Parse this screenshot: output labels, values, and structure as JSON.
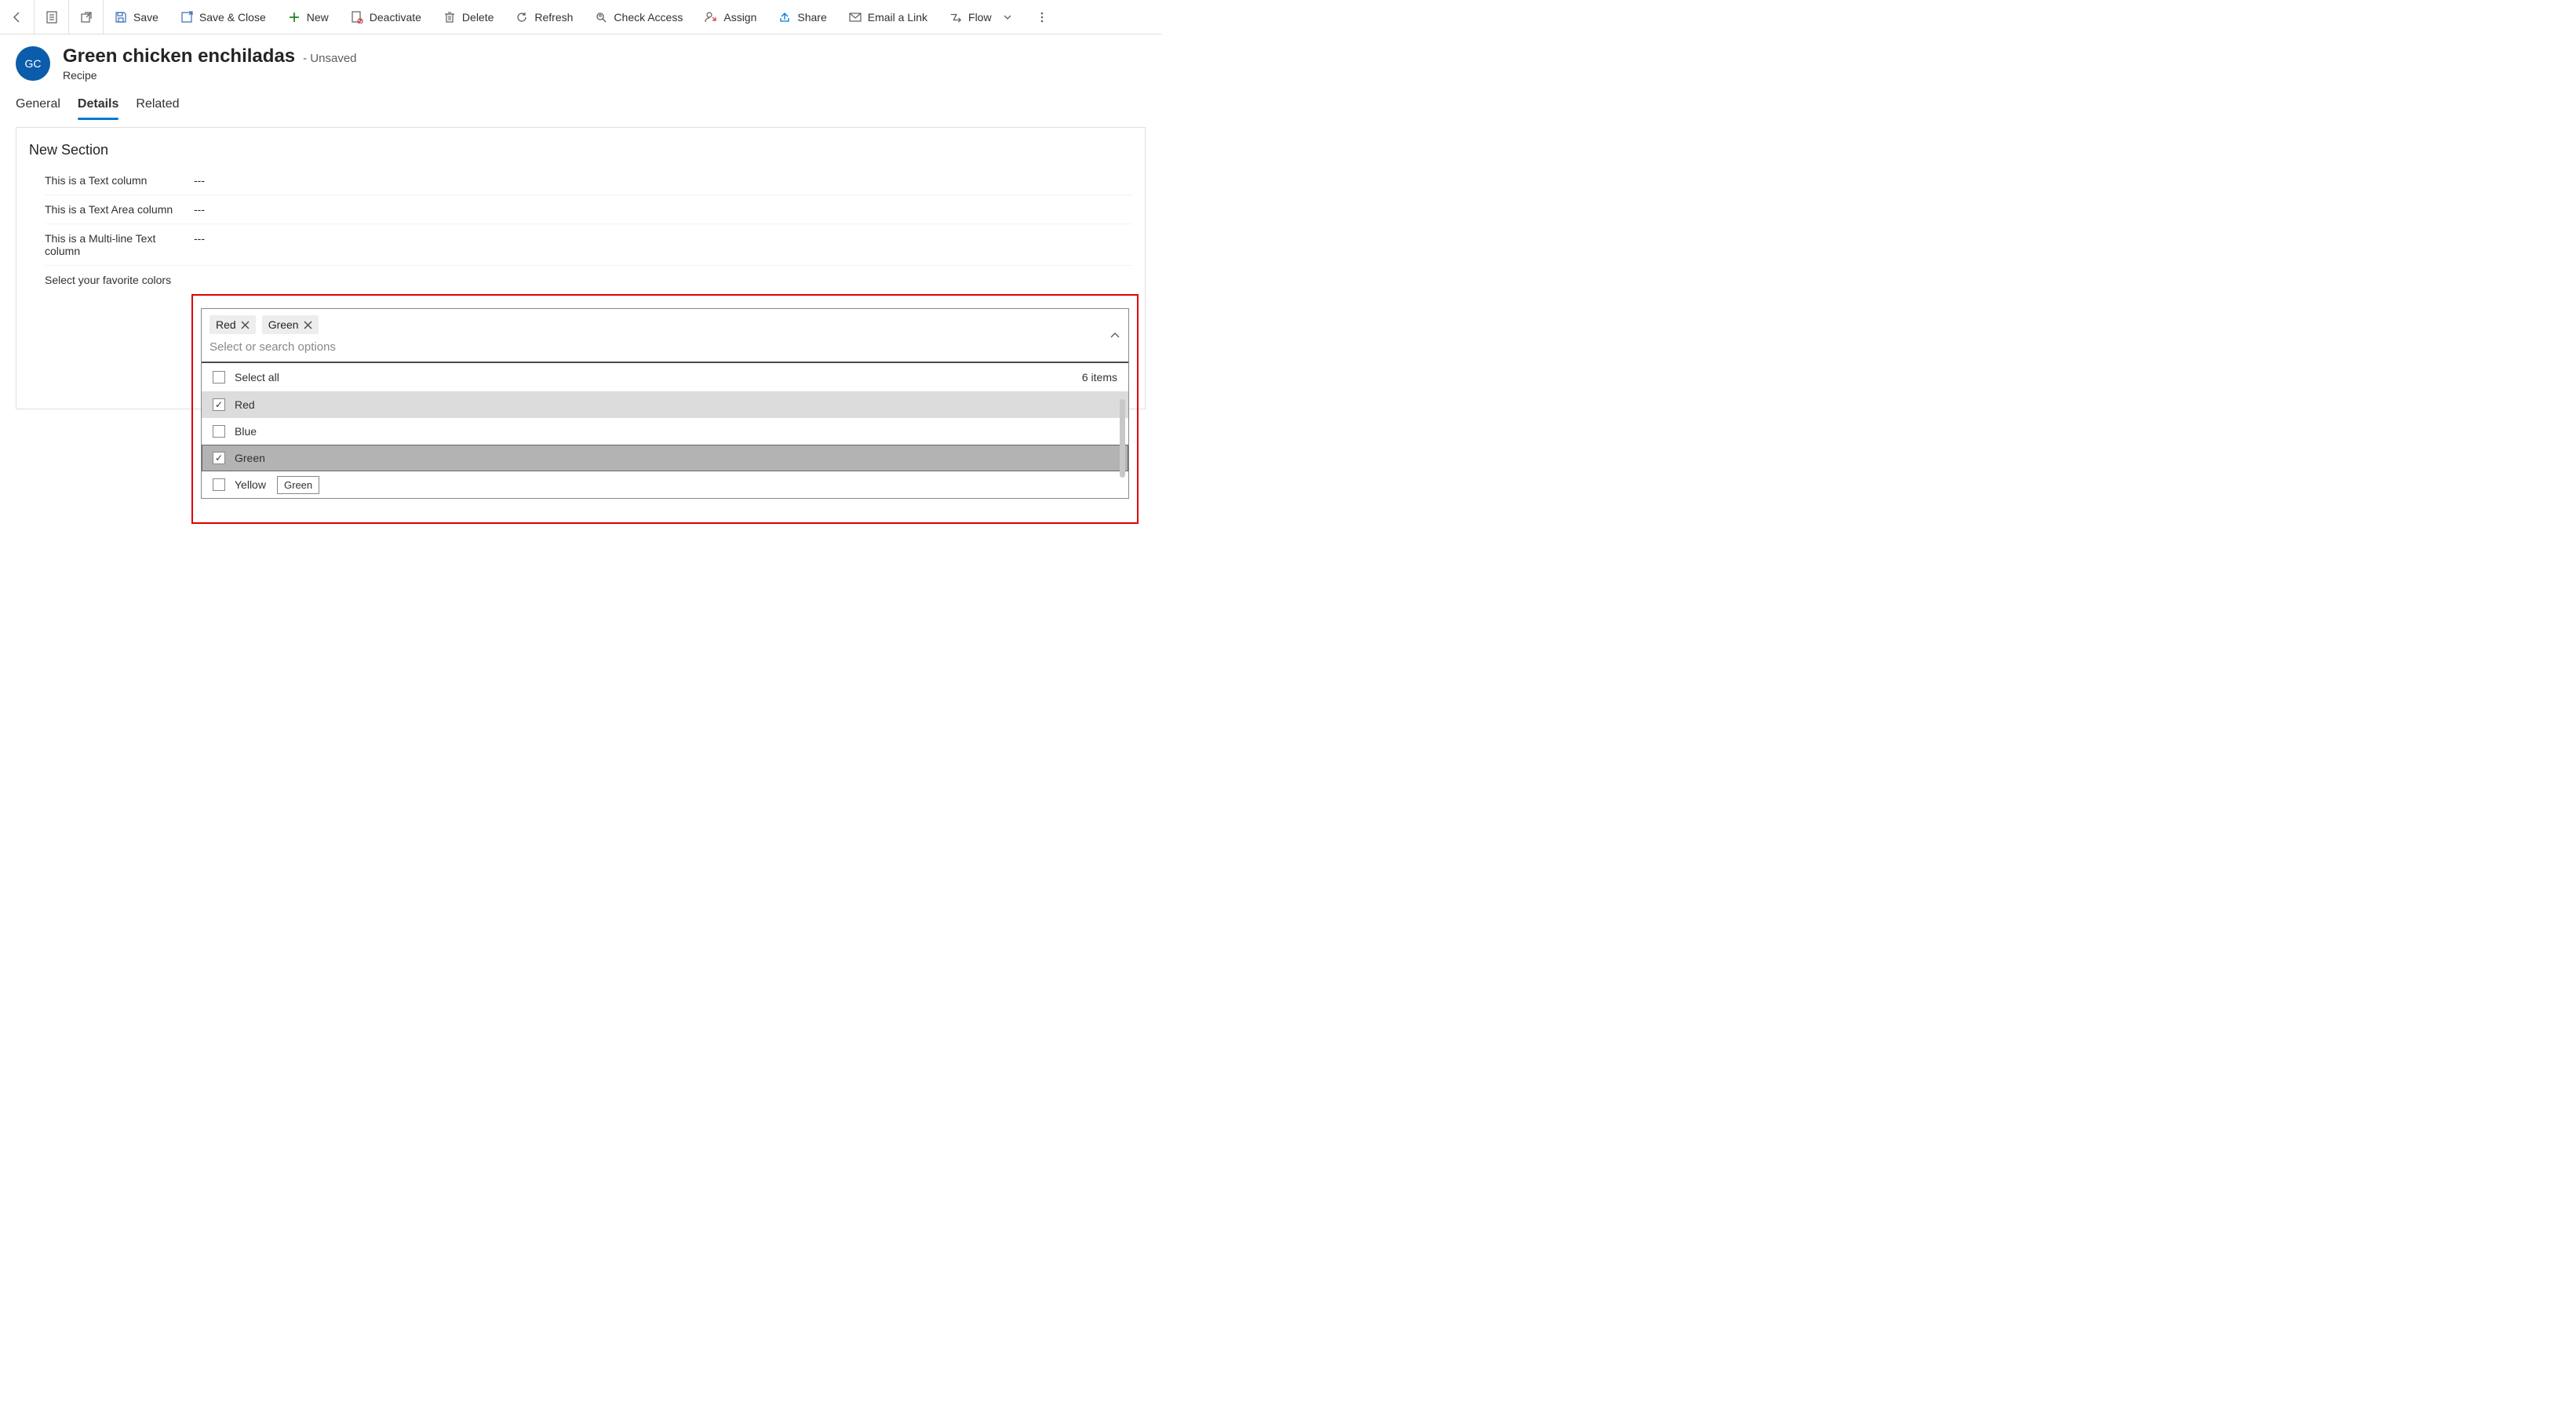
{
  "commandBar": {
    "save": "Save",
    "saveClose": "Save & Close",
    "new": "New",
    "deactivate": "Deactivate",
    "delete": "Delete",
    "refresh": "Refresh",
    "checkAccess": "Check Access",
    "assign": "Assign",
    "share": "Share",
    "emailLink": "Email a Link",
    "flow": "Flow"
  },
  "record": {
    "avatarInitials": "GC",
    "title": "Green chicken enchiladas",
    "statusSuffix": "- Unsaved",
    "entityName": "Recipe"
  },
  "tabs": {
    "general": "General",
    "details": "Details",
    "related": "Related"
  },
  "section": {
    "title": "New Section"
  },
  "fields": {
    "textLabel": "This is a Text column",
    "textValue": "---",
    "textAreaLabel": "This is a Text Area column",
    "textAreaValue": "---",
    "multiLineLabel": "This is a Multi-line Text column",
    "multiLineValue": "---",
    "colorsLabel": "Select your favorite colors"
  },
  "multiselect": {
    "chips": {
      "red": "Red",
      "green": "Green"
    },
    "placeholder": "Select or search options",
    "selectAll": "Select all",
    "countText": "6 items",
    "options": {
      "red": "Red",
      "blue": "Blue",
      "green": "Green",
      "yellow": "Yellow"
    },
    "tooltip": "Green"
  }
}
